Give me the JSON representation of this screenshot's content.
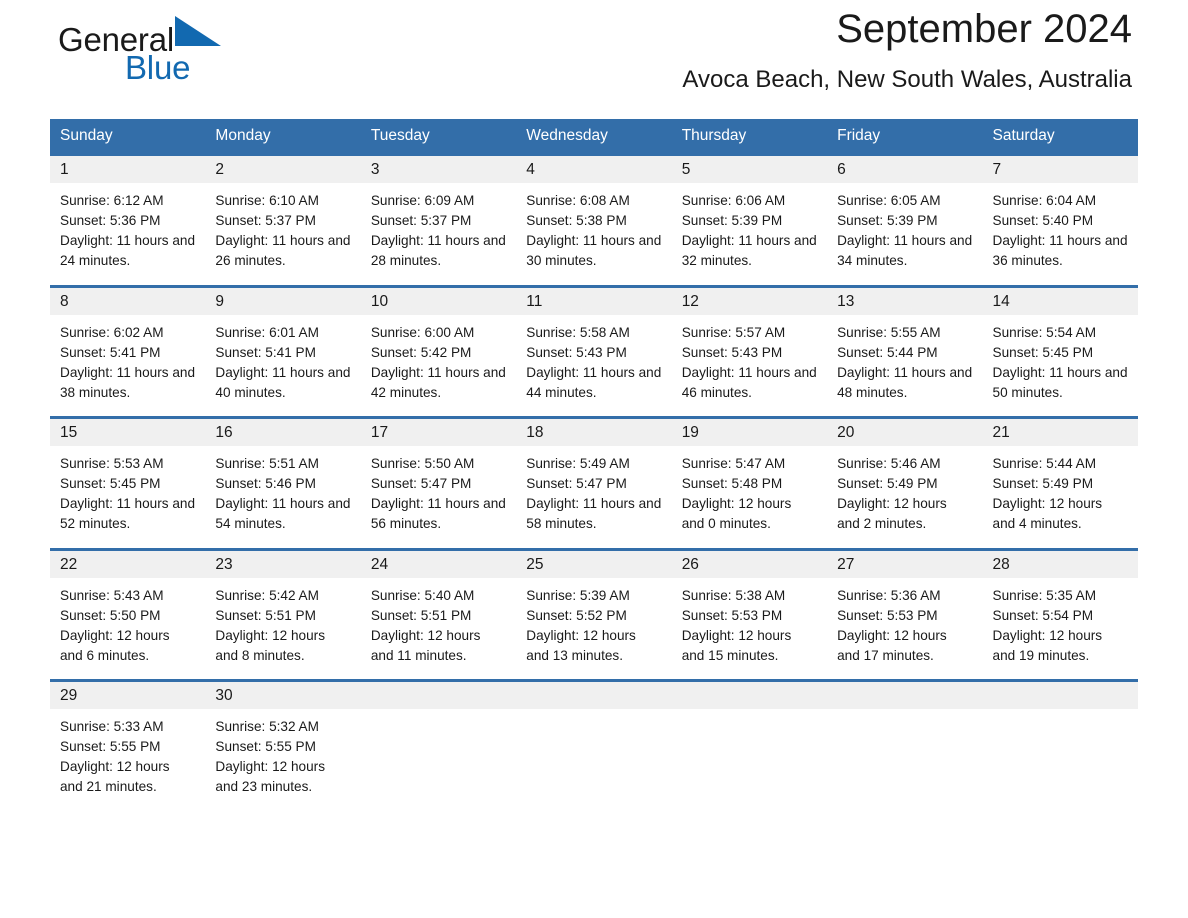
{
  "brand": {
    "name_part1": "General",
    "name_part2": "Blue",
    "triangle_icon": "triangle-icon",
    "accent_color": "#1269b0"
  },
  "header": {
    "title": "September 2024",
    "subtitle": "Avoca Beach, New South Wales, Australia"
  },
  "colors": {
    "header_blue": "#336ea9",
    "daynum_band": "#f0f0f0",
    "text": "#1a1a1a",
    "logo_blue": "#1269b0"
  },
  "weekday_headers": [
    "Sunday",
    "Monday",
    "Tuesday",
    "Wednesday",
    "Thursday",
    "Friday",
    "Saturday"
  ],
  "weeks": [
    [
      {
        "day": "1",
        "info": "Sunrise: 6:12 AM\nSunset: 5:36 PM\nDaylight: 11 hours and 24 minutes."
      },
      {
        "day": "2",
        "info": "Sunrise: 6:10 AM\nSunset: 5:37 PM\nDaylight: 11 hours and 26 minutes."
      },
      {
        "day": "3",
        "info": "Sunrise: 6:09 AM\nSunset: 5:37 PM\nDaylight: 11 hours and 28 minutes."
      },
      {
        "day": "4",
        "info": "Sunrise: 6:08 AM\nSunset: 5:38 PM\nDaylight: 11 hours and 30 minutes."
      },
      {
        "day": "5",
        "info": "Sunrise: 6:06 AM\nSunset: 5:39 PM\nDaylight: 11 hours and 32 minutes."
      },
      {
        "day": "6",
        "info": "Sunrise: 6:05 AM\nSunset: 5:39 PM\nDaylight: 11 hours and 34 minutes."
      },
      {
        "day": "7",
        "info": "Sunrise: 6:04 AM\nSunset: 5:40 PM\nDaylight: 11 hours and 36 minutes."
      }
    ],
    [
      {
        "day": "8",
        "info": "Sunrise: 6:02 AM\nSunset: 5:41 PM\nDaylight: 11 hours and 38 minutes."
      },
      {
        "day": "9",
        "info": "Sunrise: 6:01 AM\nSunset: 5:41 PM\nDaylight: 11 hours and 40 minutes."
      },
      {
        "day": "10",
        "info": "Sunrise: 6:00 AM\nSunset: 5:42 PM\nDaylight: 11 hours and 42 minutes."
      },
      {
        "day": "11",
        "info": "Sunrise: 5:58 AM\nSunset: 5:43 PM\nDaylight: 11 hours and 44 minutes."
      },
      {
        "day": "12",
        "info": "Sunrise: 5:57 AM\nSunset: 5:43 PM\nDaylight: 11 hours and 46 minutes."
      },
      {
        "day": "13",
        "info": "Sunrise: 5:55 AM\nSunset: 5:44 PM\nDaylight: 11 hours and 48 minutes."
      },
      {
        "day": "14",
        "info": "Sunrise: 5:54 AM\nSunset: 5:45 PM\nDaylight: 11 hours and 50 minutes."
      }
    ],
    [
      {
        "day": "15",
        "info": "Sunrise: 5:53 AM\nSunset: 5:45 PM\nDaylight: 11 hours and 52 minutes."
      },
      {
        "day": "16",
        "info": "Sunrise: 5:51 AM\nSunset: 5:46 PM\nDaylight: 11 hours and 54 minutes."
      },
      {
        "day": "17",
        "info": "Sunrise: 5:50 AM\nSunset: 5:47 PM\nDaylight: 11 hours and 56 minutes."
      },
      {
        "day": "18",
        "info": "Sunrise: 5:49 AM\nSunset: 5:47 PM\nDaylight: 11 hours and 58 minutes."
      },
      {
        "day": "19",
        "info": "Sunrise: 5:47 AM\nSunset: 5:48 PM\nDaylight: 12 hours and 0 minutes."
      },
      {
        "day": "20",
        "info": "Sunrise: 5:46 AM\nSunset: 5:49 PM\nDaylight: 12 hours and 2 minutes."
      },
      {
        "day": "21",
        "info": "Sunrise: 5:44 AM\nSunset: 5:49 PM\nDaylight: 12 hours and 4 minutes."
      }
    ],
    [
      {
        "day": "22",
        "info": "Sunrise: 5:43 AM\nSunset: 5:50 PM\nDaylight: 12 hours and 6 minutes."
      },
      {
        "day": "23",
        "info": "Sunrise: 5:42 AM\nSunset: 5:51 PM\nDaylight: 12 hours and 8 minutes."
      },
      {
        "day": "24",
        "info": "Sunrise: 5:40 AM\nSunset: 5:51 PM\nDaylight: 12 hours and 11 minutes."
      },
      {
        "day": "25",
        "info": "Sunrise: 5:39 AM\nSunset: 5:52 PM\nDaylight: 12 hours and 13 minutes."
      },
      {
        "day": "26",
        "info": "Sunrise: 5:38 AM\nSunset: 5:53 PM\nDaylight: 12 hours and 15 minutes."
      },
      {
        "day": "27",
        "info": "Sunrise: 5:36 AM\nSunset: 5:53 PM\nDaylight: 12 hours and 17 minutes."
      },
      {
        "day": "28",
        "info": "Sunrise: 5:35 AM\nSunset: 5:54 PM\nDaylight: 12 hours and 19 minutes."
      }
    ],
    [
      {
        "day": "29",
        "info": "Sunrise: 5:33 AM\nSunset: 5:55 PM\nDaylight: 12 hours and 21 minutes."
      },
      {
        "day": "30",
        "info": "Sunrise: 5:32 AM\nSunset: 5:55 PM\nDaylight: 12 hours and 23 minutes."
      },
      {
        "day": "",
        "info": ""
      },
      {
        "day": "",
        "info": ""
      },
      {
        "day": "",
        "info": ""
      },
      {
        "day": "",
        "info": ""
      },
      {
        "day": "",
        "info": ""
      }
    ]
  ]
}
